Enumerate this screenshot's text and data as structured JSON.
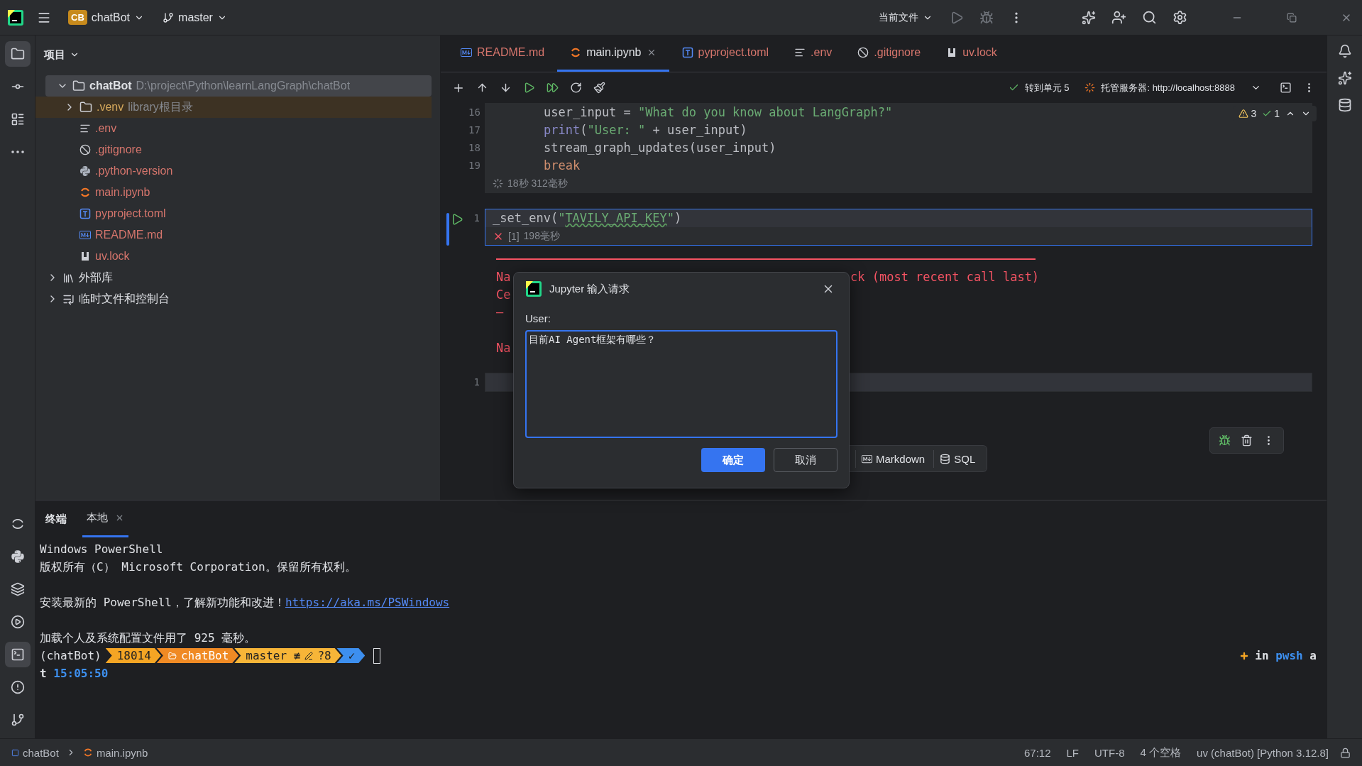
{
  "title_bar": {
    "badge": "CB",
    "project": "chatBot",
    "branch": "master",
    "run_config": "当前文件"
  },
  "tool_strip": {
    "top": [
      {
        "kind": "folder",
        "selected": true
      },
      {
        "kind": "commit",
        "selected": false
      },
      {
        "kind": "structure",
        "selected": false
      },
      {
        "kind": "more",
        "selected": false
      }
    ],
    "bottom": [
      {
        "kind": "jupyter",
        "selected": false
      },
      {
        "kind": "python",
        "selected": false
      },
      {
        "kind": "packages",
        "selected": false
      },
      {
        "kind": "services",
        "selected": false
      },
      {
        "kind": "terminal",
        "selected": true
      },
      {
        "kind": "problems",
        "selected": false
      },
      {
        "kind": "git",
        "selected": false
      }
    ]
  },
  "project_panel": {
    "title": "项目",
    "tree": [
      {
        "name": "chatBot",
        "path": "D:\\project\\Python\\learnLangGraph\\chatBot",
        "kind": "folder",
        "expanded": true,
        "selected": true,
        "children": [
          {
            "name": ".venv",
            "note": "library根目录",
            "kind": "folder",
            "color": "#d6a95c",
            "excluded": true,
            "expanded": false,
            "selected": false
          },
          {
            "name": ".env",
            "kind": "env",
            "color": "#d5756c",
            "excluded": false,
            "selected": false
          },
          {
            "name": ".gitignore",
            "kind": "gitignore",
            "color": "#d5756c",
            "excluded": false,
            "selected": false
          },
          {
            "name": ".python-version",
            "kind": "python",
            "color": "#d5756c",
            "excluded": false,
            "selected": false
          },
          {
            "name": "main.ipynb",
            "kind": "notebook",
            "color": "#d5756c",
            "excluded": false,
            "selected": false
          },
          {
            "name": "pyproject.toml",
            "kind": "toml",
            "color": "#d5756c",
            "excluded": false,
            "selected": false
          },
          {
            "name": "README.md",
            "kind": "markdown",
            "color": "#d5756c",
            "excluded": false,
            "selected": false
          },
          {
            "name": "uv.lock",
            "kind": "lock",
            "color": "#d5756c",
            "excluded": false,
            "selected": false
          }
        ]
      },
      {
        "name": "外部库",
        "kind": "library",
        "expanded": false,
        "selected": false
      },
      {
        "name": "临时文件和控制台",
        "kind": "scratch",
        "expanded": false,
        "selected": false
      }
    ]
  },
  "editor": {
    "tabs": [
      {
        "label": "README.md",
        "kind": "markdown",
        "selected": false
      },
      {
        "label": "main.ipynb",
        "kind": "notebook",
        "selected": true
      },
      {
        "label": "pyproject.toml",
        "kind": "toml",
        "selected": false
      },
      {
        "label": ".env",
        "kind": "env",
        "selected": false
      },
      {
        "label": ".gitignore",
        "kind": "gitignore",
        "selected": false
      },
      {
        "label": "uv.lock",
        "kind": "lock",
        "selected": false
      }
    ],
    "goto_cell": "转到单元 5",
    "server": "托管服务器: http://localhost:8888",
    "inspections": {
      "warnings": "3",
      "passed": "1"
    },
    "cells": [
      {
        "kind": "code",
        "running": true,
        "selected": false,
        "footer": "18秒 312毫秒",
        "lines": [
          {
            "number": "16",
            "indent": true,
            "tokens": [
              {
                "t": "user_input = ",
                "kind": "plain"
              },
              {
                "t": "\"What do you know about LangGraph?\"",
                "kind": "string"
              }
            ]
          },
          {
            "number": "17",
            "indent": true,
            "tokens": [
              {
                "t": "print",
                "kind": "builtin"
              },
              {
                "t": "(",
                "kind": "plain"
              },
              {
                "t": "\"User: \"",
                "kind": "string"
              },
              {
                "t": " + user_input)",
                "kind": "plain"
              }
            ]
          },
          {
            "number": "18",
            "indent": true,
            "tokens": [
              {
                "t": "stream_graph_updates(user_input)",
                "kind": "plain"
              }
            ]
          },
          {
            "number": "19",
            "indent": true,
            "tokens": [
              {
                "t": "break",
                "kind": "keyword"
              }
            ]
          }
        ]
      },
      {
        "kind": "code",
        "failed": true,
        "selected": true,
        "execution": "[1]",
        "footer": "198毫秒",
        "lines": [
          {
            "number": "1",
            "indent": false,
            "tokens": [
              {
                "t": "_set_env(",
                "kind": "plain"
              },
              {
                "t": "\"",
                "kind": "string"
              },
              {
                "t": "TAVILY_API_KEY",
                "kind": "typo"
              },
              {
                "t": "\"",
                "kind": "string"
              },
              {
                "t": ")",
                "kind": "plain"
              }
            ]
          }
        ]
      },
      {
        "kind": "output",
        "paragraphs": [
          [
            {
              "left": "Na",
              "right": "ck (most recent call last)"
            },
            {
              "left": "Ce"
            },
            {
              "left": "—"
            }
          ],
          [
            {
              "left": "Na"
            }
          ]
        ]
      },
      {
        "kind": "code",
        "selected": false,
        "lines": [
          {
            "number": "1"
          }
        ]
      }
    ],
    "add_cell": [
      "Markdown",
      "SQL"
    ]
  },
  "dialog": {
    "title": "Jupyter 输入请求",
    "label": "User:",
    "value": "目前AI Agent框架有哪些？",
    "ok": "确定",
    "cancel": "取消"
  },
  "terminal": {
    "title": "终端",
    "tabs": [
      {
        "label": "本地",
        "selected": true
      }
    ],
    "paragraphs": [
      [
        {
          "text": "Windows PowerShell"
        },
        {
          "text": "版权所有（C） Microsoft Corporation。保留所有权利。"
        }
      ],
      [
        {
          "text": "安装最新的 PowerShell，了解新功能和改进！",
          "link": "https://aka.ms/PSWindows"
        }
      ],
      [
        {
          "text": "加载个人及系统配置文件用了 925 毫秒。"
        }
      ]
    ],
    "prompt": {
      "env": "(chatBot)",
      "segments": [
        {
          "text": "18014",
          "color": "#f5a524"
        },
        {
          "text": "chatBot",
          "color": "#f08a24",
          "kind": "folder"
        },
        {
          "text": "master ≢",
          "extra": "?8",
          "color": "#f7b538",
          "kind": "git"
        },
        {
          "text": "✓",
          "color": "#3d8fef",
          "kind": "status"
        }
      ],
      "right": {
        "word": "in",
        "shell": "pwsh",
        "head": "a"
      },
      "tail": "t",
      "time": "15:05:50"
    }
  },
  "status_bar": {
    "crumbs": [
      "chatBot",
      "main.ipynb"
    ],
    "items": [
      "67:12",
      "LF",
      "UTF-8",
      "4 个空格",
      "uv (chatBot) [Python 3.12.8]"
    ]
  }
}
